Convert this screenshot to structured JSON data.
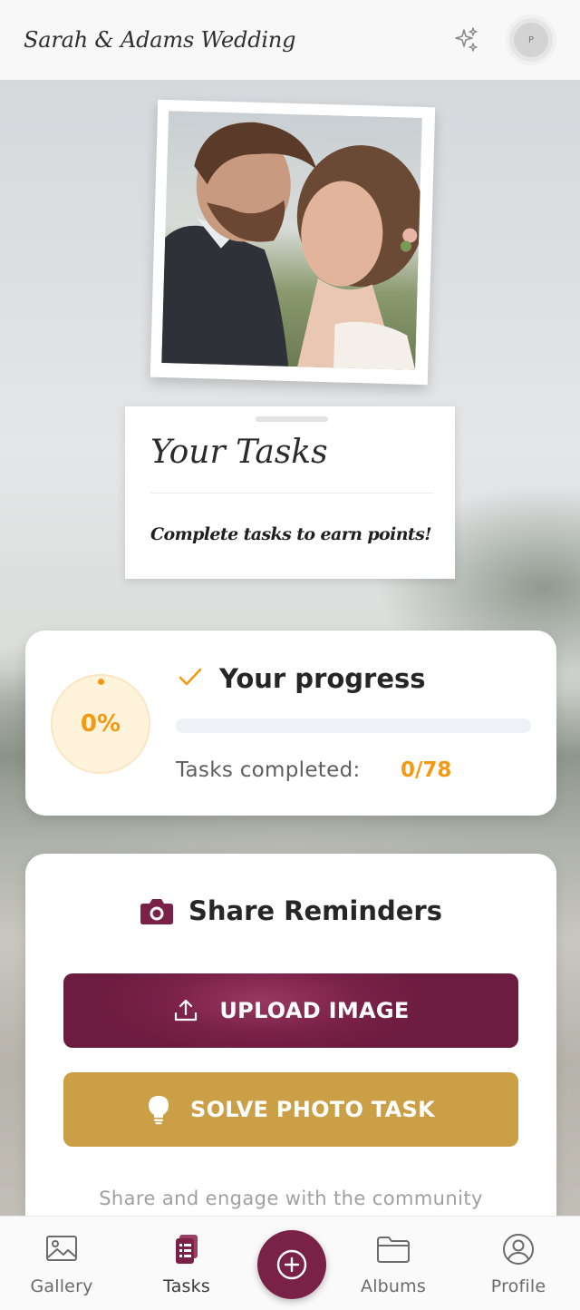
{
  "header": {
    "title": "Sarah & Adams Wedding",
    "avatar_initial": "P",
    "sparkle_icon": "sparkle-icon"
  },
  "hero": {
    "photo": "couple-photo"
  },
  "tasks_note": {
    "title": "Your Tasks",
    "subtitle": "Complete tasks to earn points!"
  },
  "progress": {
    "percent_label": "0%",
    "percent": 0,
    "title": "Your progress",
    "completed_label": "Tasks completed:",
    "completed_count": "0/78",
    "accent": "#f29a12"
  },
  "share": {
    "title": "Share Reminders",
    "upload_label": "UPLOAD IMAGE",
    "solve_label": "SOLVE PHOTO TASK",
    "footer": "Share and engage with the community",
    "upload_color": "#7a2148",
    "solve_color": "#ca9f46"
  },
  "nav": {
    "items": [
      {
        "label": "Gallery",
        "icon": "image-icon"
      },
      {
        "label": "Tasks",
        "icon": "clipboard-icon"
      },
      {
        "label": "Albums",
        "icon": "folder-icon"
      },
      {
        "label": "Profile",
        "icon": "user-circle-icon"
      }
    ],
    "fab_icon": "plus-circle-icon",
    "active": "Tasks"
  }
}
